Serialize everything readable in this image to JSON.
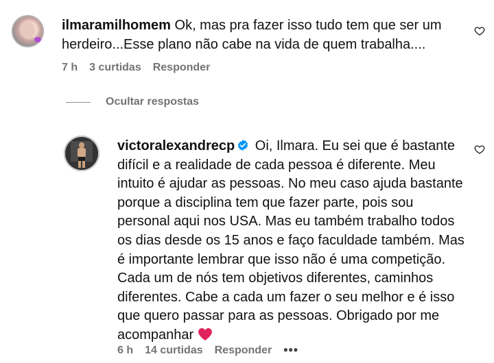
{
  "comment": {
    "username": "ilmaramilhomem",
    "text": "Ok, mas pra fazer isso tudo tem que ser um herdeiro...Esse plano não cabe na vida de quem trabalha....",
    "time": "7 h",
    "likes": "3 curtidas",
    "reply_label": "Responder"
  },
  "thread": {
    "hide_replies_label": "Ocultar respostas"
  },
  "reply": {
    "username": "victoralexandrecp",
    "text": "Oi, Ilmara. Eu sei que é bastante difícil e a realidade de cada pessoa é diferente. Meu intuito é ajudar as pessoas. No meu caso ajuda bastante porque a disciplina tem que fazer parte, pois sou personal aqui nos USA. Mas eu também trabalho todos os dias desde os 15 anos e faço faculdade também. Mas é importante lembrar que isso não é uma competição. Cada um de nós tem objetivos diferentes, caminhos diferentes. Cabe a cada um fazer o seu melhor e é isso que quero passar para as pessoas. Obrigado por me acompanhar",
    "time": "6 h",
    "likes": "14 curtidas",
    "reply_label": "Responder",
    "more_label": "•••"
  },
  "colors": {
    "text": "#111111",
    "meta": "#737373",
    "verified": "#0095f6",
    "heart_emoji": "#e0245e"
  }
}
